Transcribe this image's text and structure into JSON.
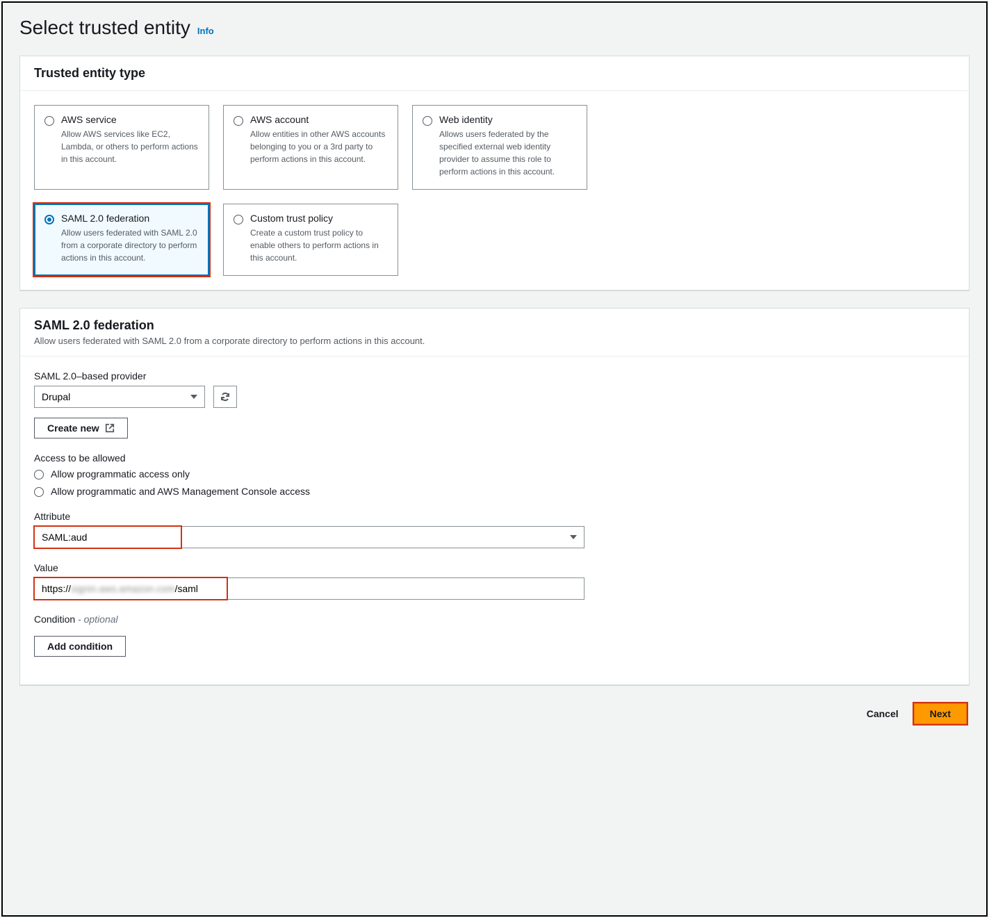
{
  "header": {
    "title": "Select trusted entity",
    "info": "Info"
  },
  "entity_panel": {
    "title": "Trusted entity type",
    "cards": [
      {
        "title": "AWS service",
        "desc": "Allow AWS services like EC2, Lambda, or others to perform actions in this account.",
        "selected": false
      },
      {
        "title": "AWS account",
        "desc": "Allow entities in other AWS accounts belonging to you or a 3rd party to perform actions in this account.",
        "selected": false
      },
      {
        "title": "Web identity",
        "desc": "Allows users federated by the specified external web identity provider to assume this role to perform actions in this account.",
        "selected": false
      },
      {
        "title": "SAML 2.0 federation",
        "desc": "Allow users federated with SAML 2.0 from a corporate directory to perform actions in this account.",
        "selected": true
      },
      {
        "title": "Custom trust policy",
        "desc": "Create a custom trust policy to enable others to perform actions in this account.",
        "selected": false
      }
    ]
  },
  "saml_panel": {
    "title": "SAML 2.0 federation",
    "subtitle": "Allow users federated with SAML 2.0 from a corporate directory to perform actions in this account.",
    "provider_label": "SAML 2.0–based provider",
    "provider_value": "Drupal",
    "create_new": "Create new",
    "access_label": "Access to be allowed",
    "access_options": [
      "Allow programmatic access only",
      "Allow programmatic and AWS Management Console access"
    ],
    "attribute_label": "Attribute",
    "attribute_value": "SAML:aud",
    "value_label": "Value",
    "value_prefix": "https://",
    "value_blurred": "signin.aws.amazon.com",
    "value_suffix": "/saml",
    "condition_label": "Condition",
    "condition_optional": " - optional",
    "add_condition": "Add condition"
  },
  "footer": {
    "cancel": "Cancel",
    "next": "Next"
  }
}
